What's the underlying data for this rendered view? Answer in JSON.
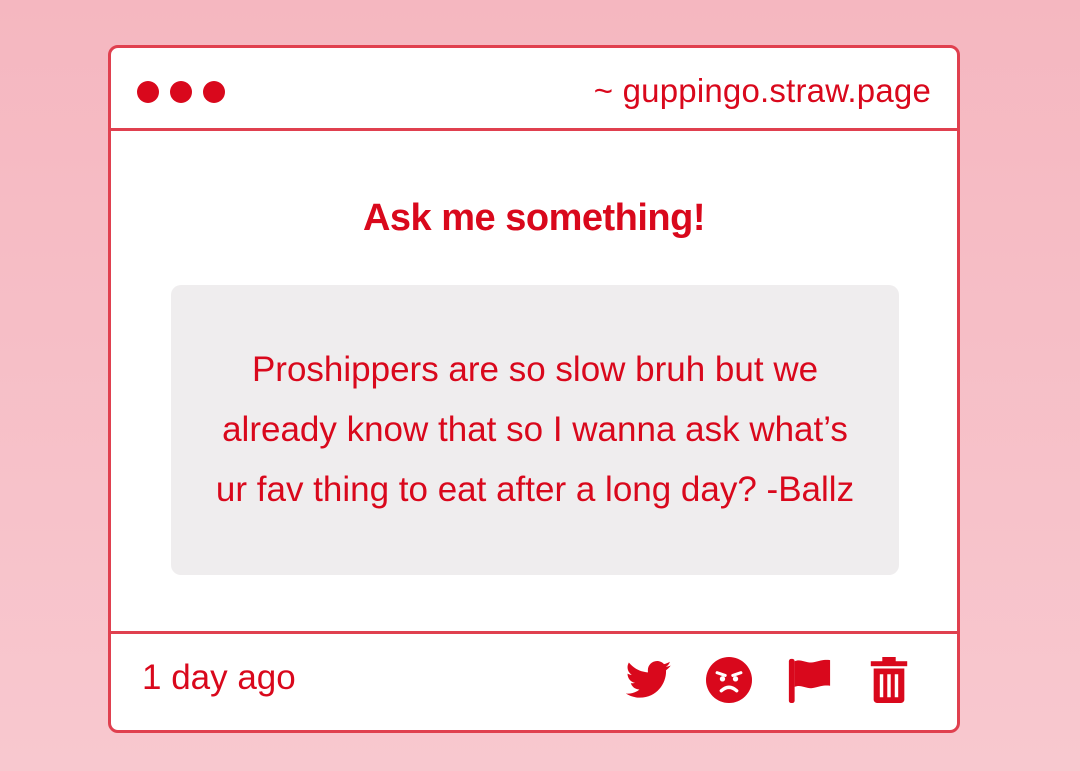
{
  "window": {
    "url": "~ guppingo.straw.page",
    "traffic_lights": [
      "dot",
      "dot",
      "dot"
    ]
  },
  "card": {
    "heading": "Ask me something!",
    "question": "Proshippers are so slow bruh but we already know that so I wanna ask what’s ur fav thing to eat after a long day? -Ballz",
    "timestamp": "1 day ago"
  },
  "actions": [
    {
      "icon": "twitter-icon",
      "label": "share on twitter"
    },
    {
      "icon": "angry-face-icon",
      "label": "block"
    },
    {
      "icon": "flag-icon",
      "label": "report"
    },
    {
      "icon": "trash-icon",
      "label": "delete"
    }
  ],
  "colors": {
    "accent": "#d9081c",
    "border": "#e0404f",
    "background_top": "#f5b7c0",
    "background_bottom": "#f8c8cf",
    "question_box": "#efedee",
    "card": "#ffffff"
  }
}
